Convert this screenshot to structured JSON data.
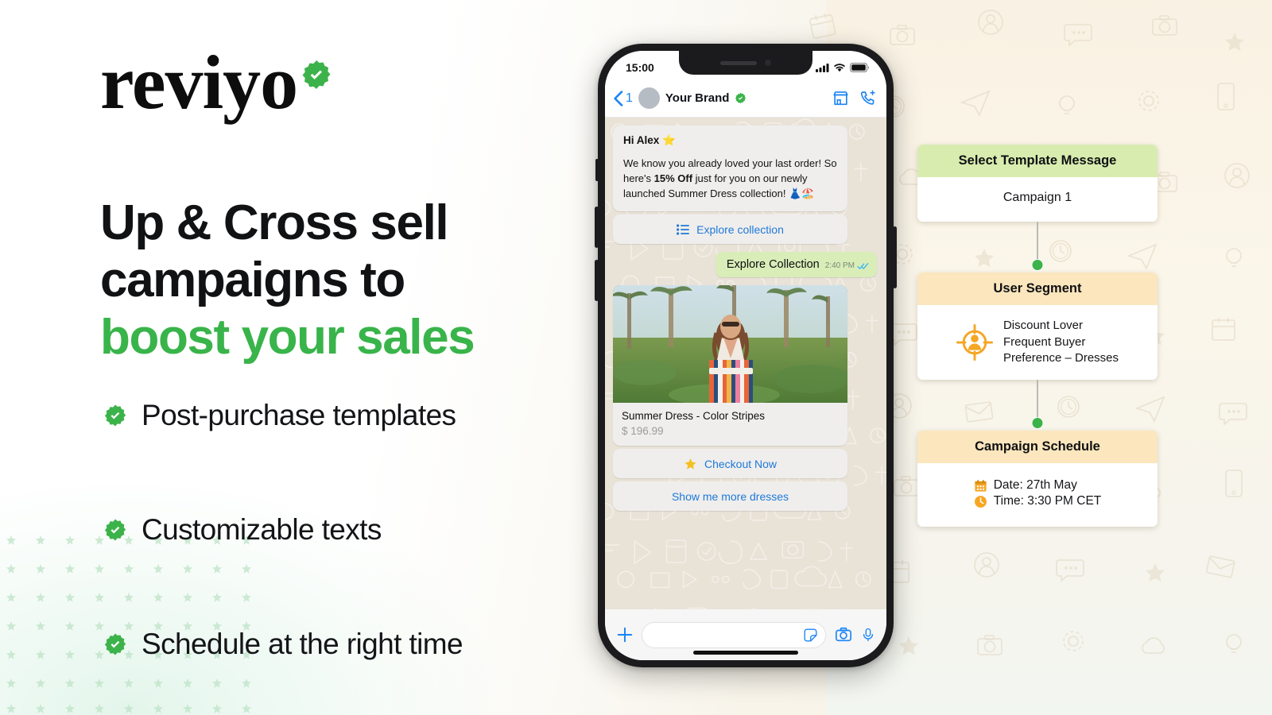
{
  "brand": {
    "logo_text": "reviyo",
    "logo_badge_icon": "verified-check-badge"
  },
  "hero": {
    "headline_line1": "Up & Cross sell",
    "headline_line2": "campaigns to",
    "headline_line3": "boost your sales",
    "accent_color": "#39b44a"
  },
  "features": [
    {
      "icon": "verified-check-badge",
      "label": "Post-purchase templates"
    },
    {
      "icon": "verified-check-badge",
      "label": "Customizable texts"
    },
    {
      "icon": "verified-check-badge",
      "label": "Schedule at the right time"
    }
  ],
  "phone": {
    "status_bar": {
      "time": "15:00",
      "icons": [
        "cellular-signal-icon",
        "wifi-icon",
        "battery-icon"
      ]
    },
    "chat_header": {
      "back_icon": "chevron-left-icon",
      "unread_count": "1",
      "avatar": "contact-avatar",
      "contact_name": "Your Brand",
      "verified_icon": "verified-check-badge",
      "action_icons": [
        "storefront-icon",
        "phone-add-icon"
      ]
    },
    "messages": {
      "incoming": {
        "title": "Hi Alex ⭐",
        "body_part1": "We know you already loved your last order! So here's ",
        "body_bold": "15% Off",
        "body_part2": " just for you on our newly launched Summer Dress collection! 👗🏖️",
        "action_button": {
          "icon": "list-icon",
          "label": "Explore collection"
        }
      },
      "outgoing": {
        "text": "Explore Collection",
        "time": "2:40 PM",
        "status_icon": "double-check-read-icon"
      },
      "product_card": {
        "image_alt": "woman-in-striped-summer-dress-photo",
        "name": "Summer Dress - Color Stripes",
        "price": "$ 196.99"
      },
      "product_buttons": [
        {
          "icon": "star-icon",
          "label": "Checkout Now"
        },
        {
          "icon": "",
          "label": "Show me more dresses"
        }
      ]
    },
    "composer": {
      "plus_icon": "plus-icon",
      "input_value": "",
      "input_placeholder": "",
      "sticker_icon": "sticker-icon",
      "camera_icon": "camera-icon",
      "mic_icon": "microphone-icon"
    }
  },
  "flow": {
    "cards": [
      {
        "title": "Select Template Message",
        "header_color": "#d8ecaf",
        "type": "single",
        "value": "Campaign 1"
      },
      {
        "title": "User Segment",
        "header_color": "#fbe6bd",
        "type": "icon-lines",
        "icon": "target-user-icon",
        "lines": [
          "Discount Lover",
          "Frequent Buyer",
          "Preference – Dresses"
        ]
      },
      {
        "title": "Campaign Schedule",
        "header_color": "#fbe6bd",
        "type": "schedule",
        "rows": [
          {
            "icon": "calendar-icon",
            "text": "Date: 27th May"
          },
          {
            "icon": "clock-icon",
            "text": "Time: 3:30 PM CET"
          }
        ]
      }
    ],
    "connector_dot_color": "#3cb34a"
  }
}
